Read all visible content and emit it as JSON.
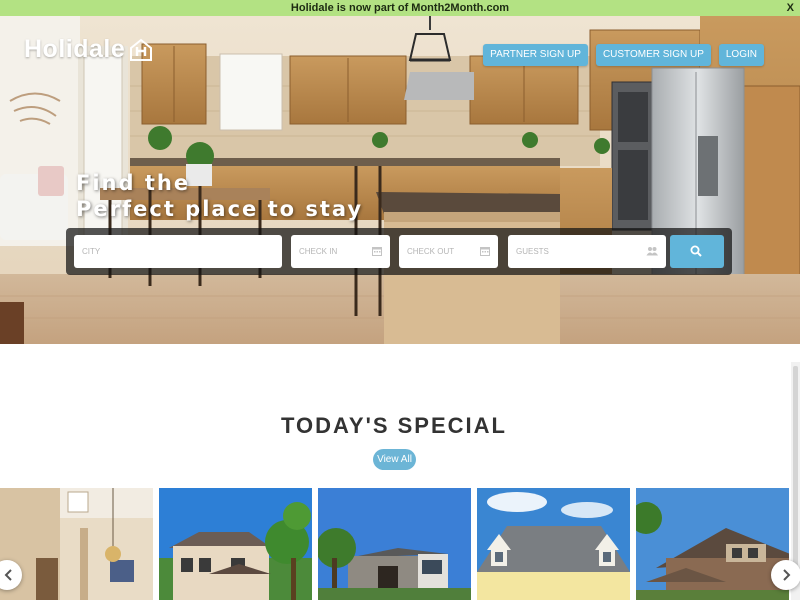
{
  "announcement": {
    "text": "Holidale is now part of Month2Month.com",
    "close_label": "X"
  },
  "brand": {
    "name": "Holidale"
  },
  "nav": {
    "partner_signup": "PARTNER SIGN UP",
    "customer_signup": "CUSTOMER SIGN UP",
    "login": "LOGIN"
  },
  "hero": {
    "headline_line1": "Find the",
    "headline_line2": "Perfect place to stay"
  },
  "search": {
    "city_placeholder": "CITY",
    "checkin_placeholder": "CHECK IN",
    "checkout_placeholder": "CHECK OUT",
    "guests_placeholder": "GUESTS",
    "icons": {
      "checkin": "calendar-icon",
      "checkout": "calendar-icon",
      "guests": "users-icon",
      "submit": "search-icon"
    }
  },
  "specials": {
    "title": "TODAY'S SPECIAL",
    "view_all": "View All"
  },
  "carousel": {
    "prev_icon": "chevron-left-icon",
    "next_icon": "chevron-right-icon"
  },
  "colors": {
    "accent": "#61b5da",
    "announcement_bg": "#b3e283",
    "heading": "#333333"
  }
}
